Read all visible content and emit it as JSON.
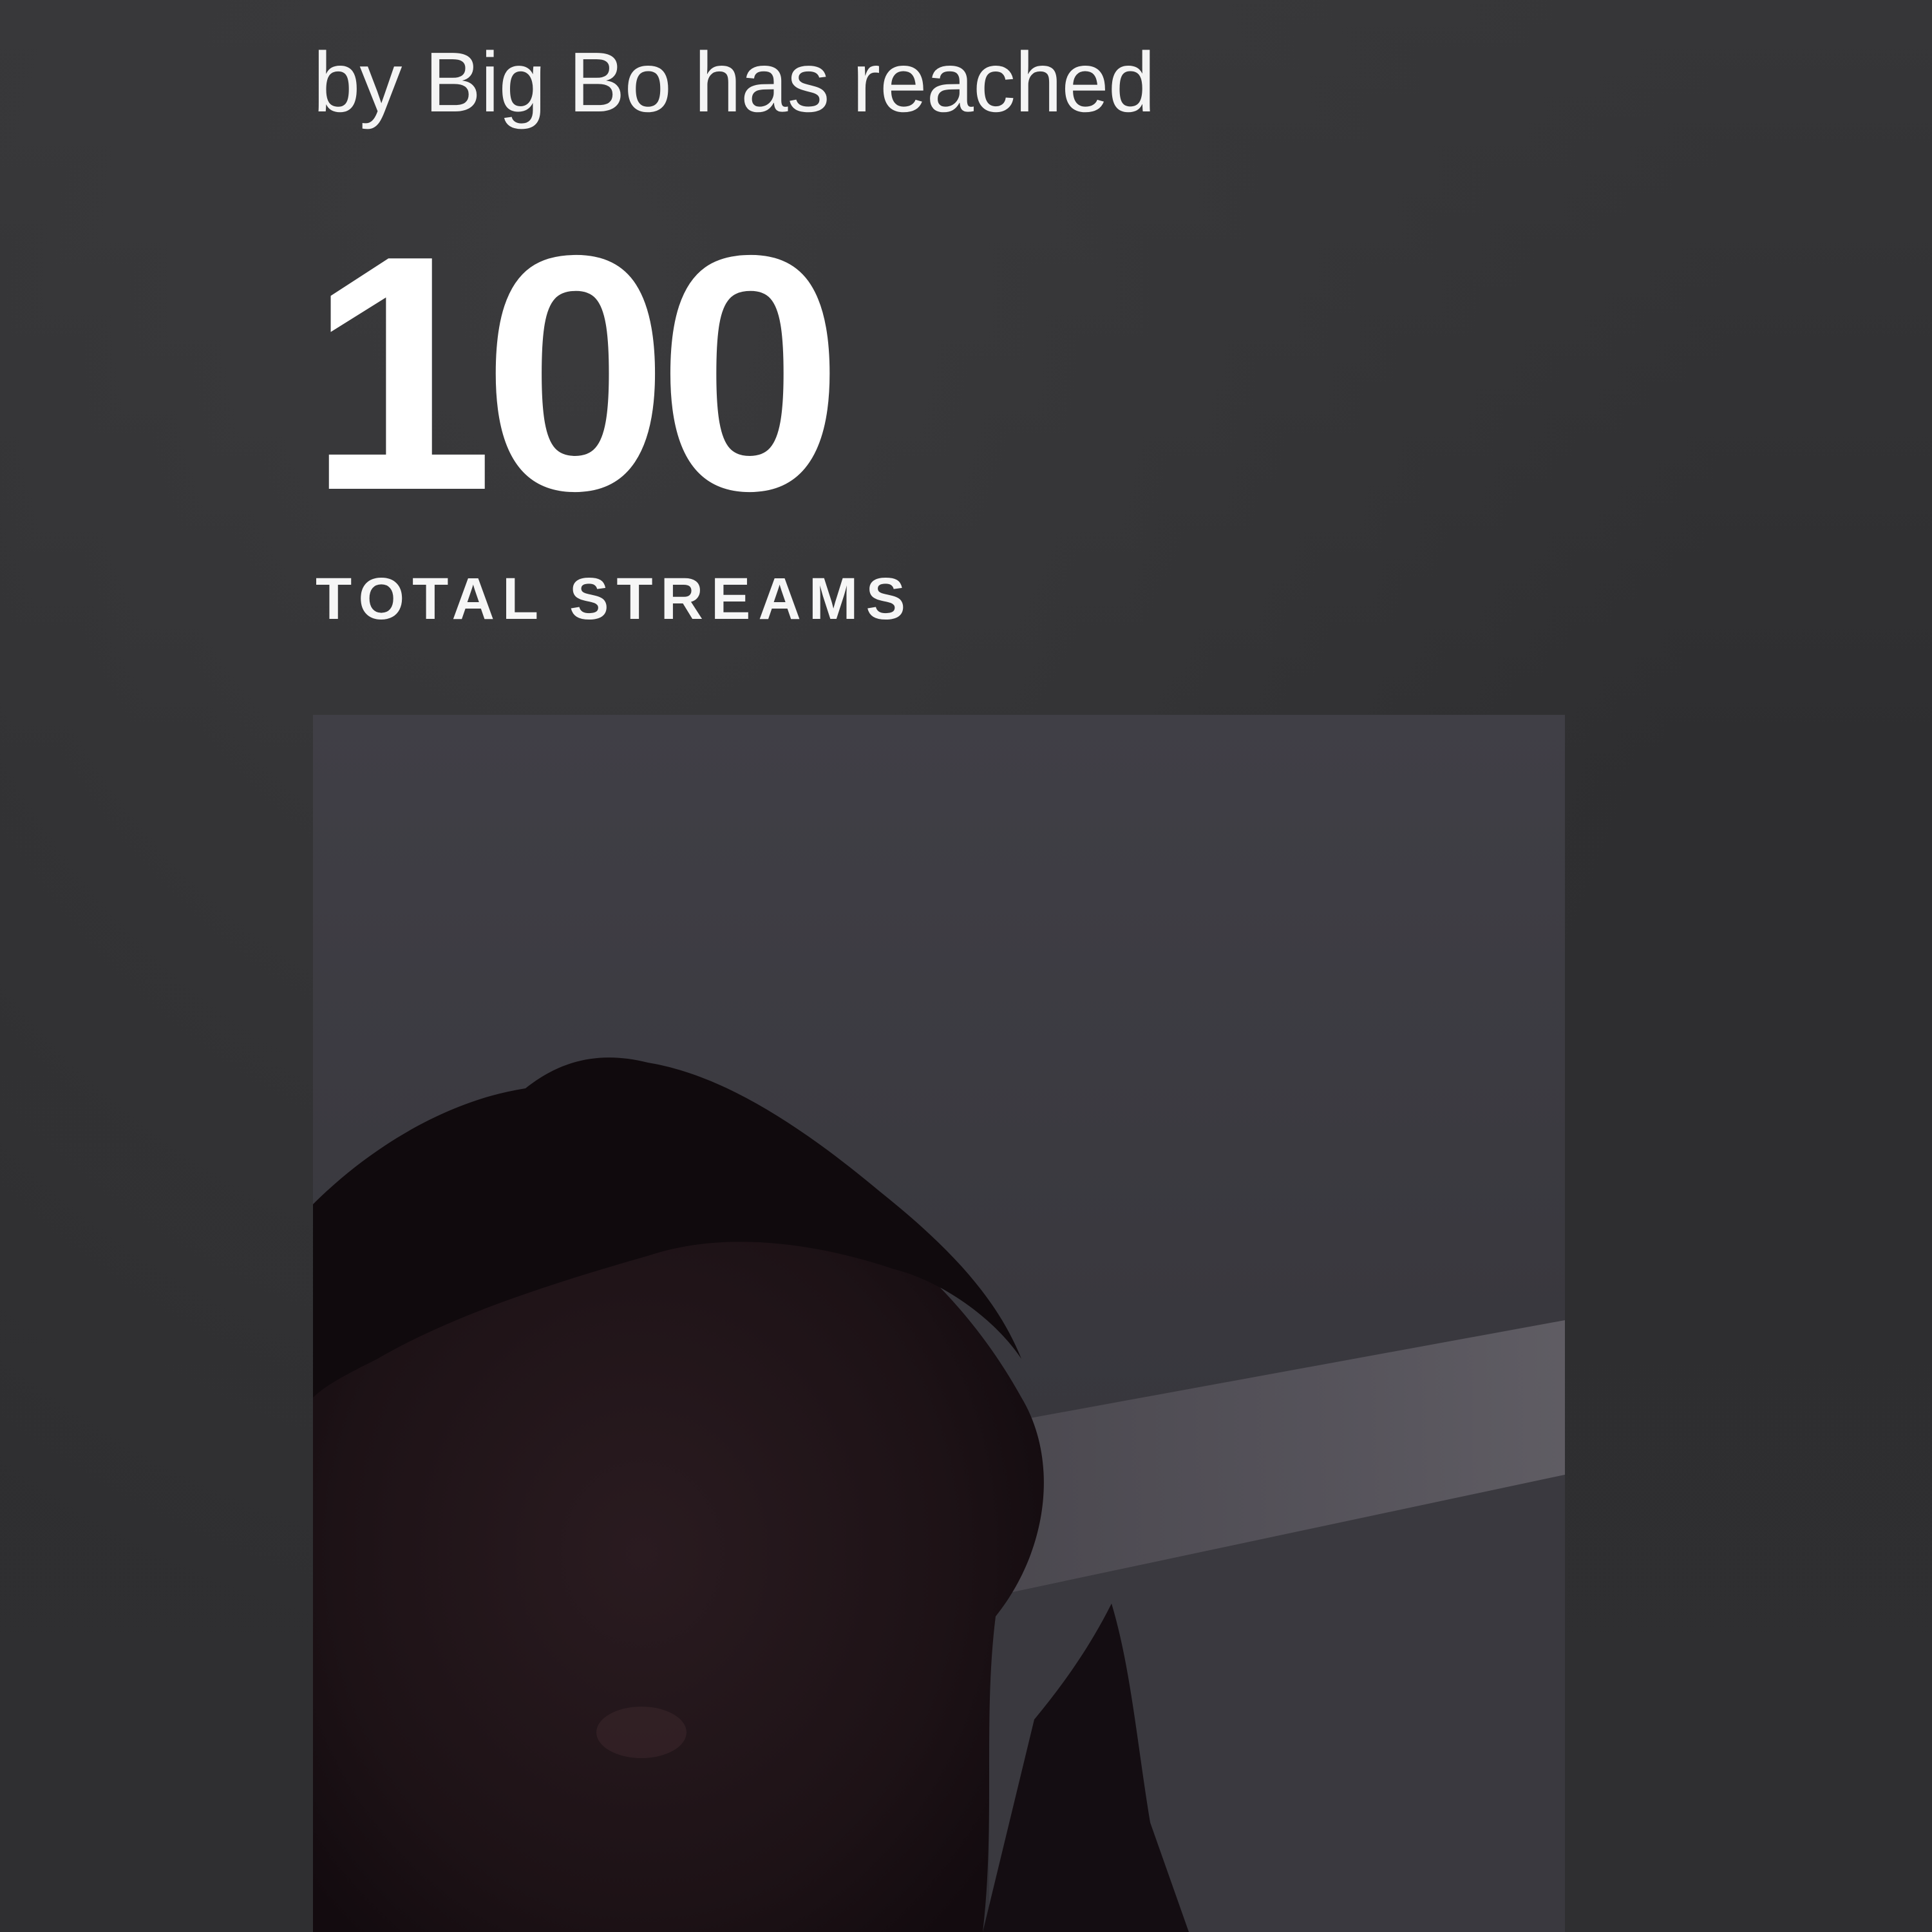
{
  "milestone": {
    "subtitle": "by Big Bo has reached",
    "count": "100",
    "count_label": "TOTAL STREAMS"
  },
  "artist_photo": {
    "description_icon": "artist-photo"
  },
  "colors": {
    "background": "#2e2e30",
    "text": "#ffffff"
  }
}
